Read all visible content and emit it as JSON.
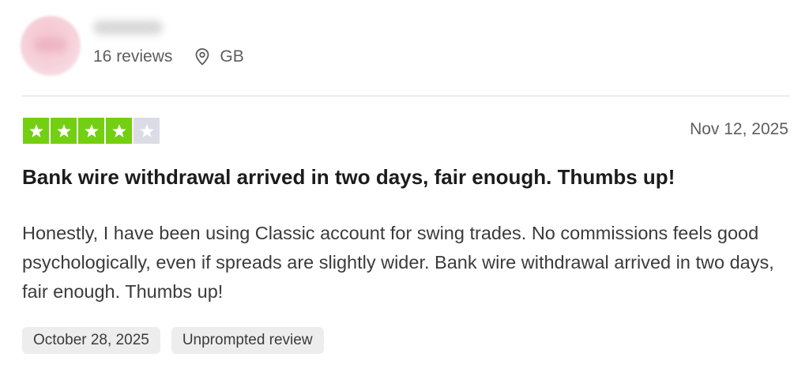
{
  "reviewer": {
    "reviews_count": "16 reviews",
    "location": "GB"
  },
  "review": {
    "rating": 4,
    "rating_max": 5,
    "date": "Nov 12, 2025",
    "title": "Bank wire withdrawal arrived in two days, fair enough. Thumbs up!",
    "body": "Honestly, I have been using Classic account for swing trades. No commissions feels good psychologically, even if spreads are slightly wider. Bank wire withdrawal arrived in two days, fair enough. Thumbs up!",
    "experience_date": "October 28, 2025",
    "review_type": "Unprompted review"
  },
  "colors": {
    "star_on": "#73cf11",
    "star_off": "#dcdce6"
  },
  "icons": {
    "location": "location-pin-icon",
    "star": "star-icon"
  }
}
